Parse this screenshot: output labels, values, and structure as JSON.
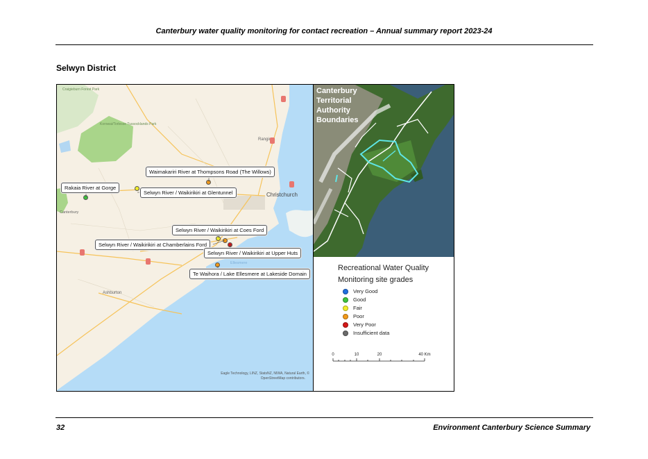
{
  "header": {
    "title": "Canterbury water quality monitoring for contact recreation – Annual summary report 2023-24"
  },
  "section": {
    "title": "Selwyn District"
  },
  "streetmap": {
    "place_labels": {
      "christchurch": "Christchurch",
      "rangiora": "Rangiora",
      "ashburton": "Ashburton",
      "canterbury": "Canterbury",
      "forest_park": "Craigieburn Forest Park",
      "conservation_park": "Korowai/Torlesse Tussocklands Park",
      "lake": "Ellesmere"
    },
    "sites": [
      {
        "label": "Waimakariri River at Thompsons Road (The Willows)",
        "grade": "Poor"
      },
      {
        "label": "Rakaia River at Gorge",
        "grade": "Good"
      },
      {
        "label": "Selwyn River / Waikirikiri at Glentunnel",
        "grade": "Fair"
      },
      {
        "label": "Selwyn River / Waikirikiri at Coes Ford",
        "grade": "Fair"
      },
      {
        "label": "Selwyn River / Waikirikiri at Chamberlains Ford",
        "grade": "Poor"
      },
      {
        "label": "Selwyn River / Waikirikiri at Upper Huts",
        "grade": "Very Poor"
      },
      {
        "label": "Te Waihora / Lake Ellesmere at Lakeside Domain",
        "grade": "Poor"
      }
    ],
    "attribution_line1": "Eagle Technology, LINZ, StatsNZ, NIWA, Natural Earth, ©",
    "attribution_line2": "OpenStreetMap contributors."
  },
  "inset": {
    "title_lines": [
      "Canterbury",
      "Territorial",
      "Authority",
      "Boundaries"
    ]
  },
  "legend": {
    "title_line1": "Recreational Water Quality",
    "title_line2": "Monitoring site grades",
    "items": [
      {
        "label": "Very Good",
        "color": "#1f6fe0"
      },
      {
        "label": "Good",
        "color": "#3ec43e"
      },
      {
        "label": "Fair",
        "color": "#f2ee2a"
      },
      {
        "label": "Poor",
        "color": "#f29a1a"
      },
      {
        "label": "Very Poor",
        "color": "#d41818"
      },
      {
        "label": "Insufficient data",
        "color": "#6b6b6b"
      }
    ],
    "scale": {
      "ticks": [
        "0",
        "10",
        "20",
        "40 Km"
      ]
    }
  },
  "footer": {
    "page_number": "32",
    "right_text": "Environment Canterbury Science Summary"
  }
}
